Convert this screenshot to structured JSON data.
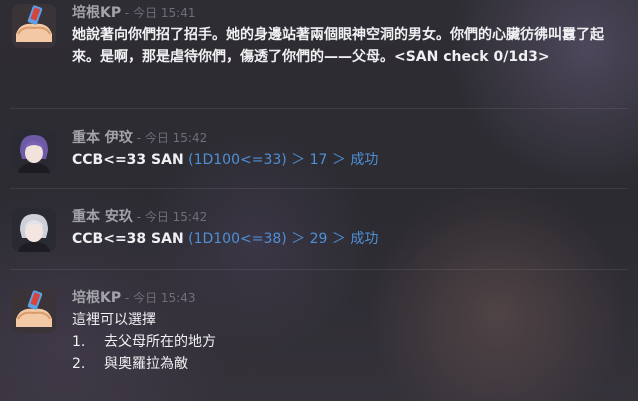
{
  "messages": [
    {
      "author": "培根KP",
      "dash": " - ",
      "time": "今日 15:41",
      "avatar_icon": "bread-kp-avatar-icon",
      "text": "她說著向你們招了招手。她的身邊站著兩個眼神空洞的男女。你們的心臟彷彿叫囂了起來。是啊，那是虐待你們，傷透了你們的——父母。<SAN check 0/1d3>"
    },
    {
      "author": "重本 伊玟",
      "dash": " - ",
      "time": "今日 15:42",
      "avatar_icon": "purple-hair-character-avatar-icon",
      "roll_prefix": "CCB<=33 SAN",
      "roll_detail": " (1D100<=33) ＞ 17 ＞ 成功"
    },
    {
      "author": "重本 安玖",
      "dash": " - ",
      "time": "今日 15:42",
      "avatar_icon": "white-hair-character-avatar-icon",
      "roll_prefix": "CCB<=38 SAN",
      "roll_detail": " (1D100<=38) ＞ 29 ＞ 成功"
    },
    {
      "author": "培根KP",
      "dash": " - ",
      "time": "今日 15:43",
      "avatar_icon": "bread-kp-avatar-icon",
      "text": "這裡可以選擇",
      "list": [
        {
          "num": "1.",
          "label": "去父母所在的地方"
        },
        {
          "num": "2.",
          "label": "與奧羅拉為敵"
        }
      ]
    }
  ],
  "colors": {
    "name": "#a3a3aa",
    "time": "#6f6f78",
    "text": "#f0f0f2",
    "roll": "#4f8fd6"
  }
}
